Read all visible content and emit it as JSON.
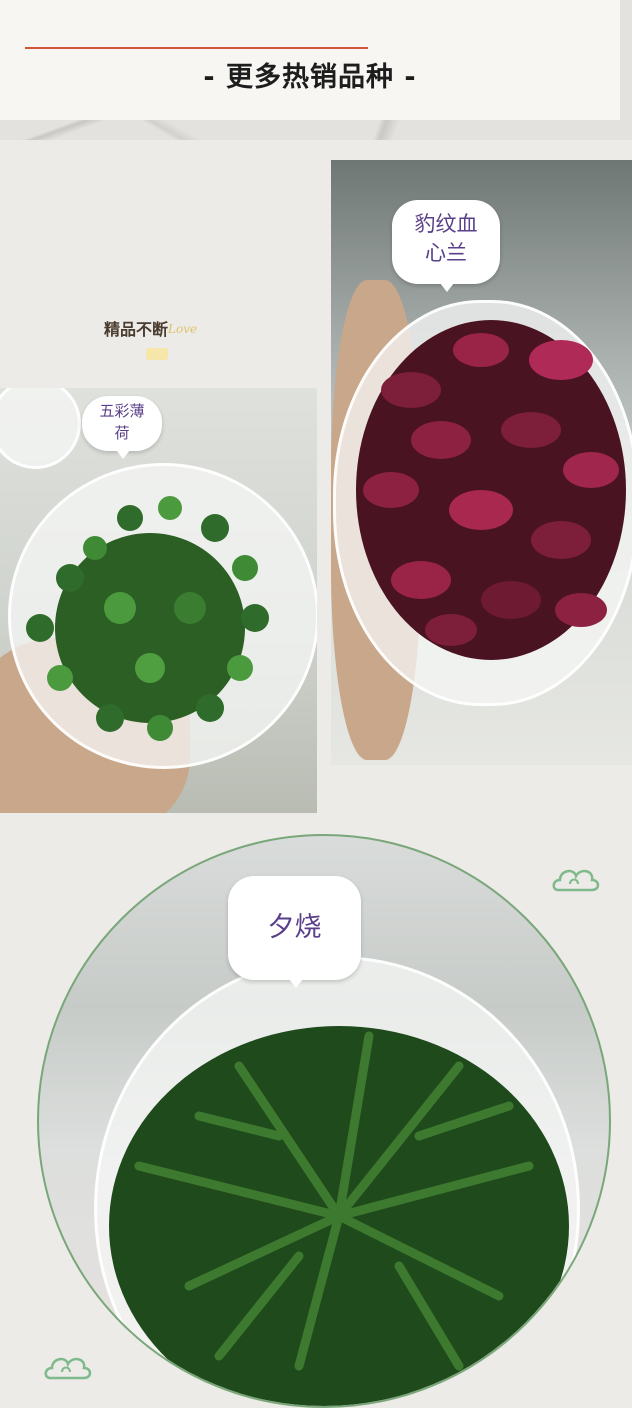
{
  "header": {
    "title": "- 更多热销品种 -"
  },
  "tagline": {
    "text": "精品不断",
    "script": "Love"
  },
  "products": [
    {
      "name": "五彩薄荷",
      "line1": "五彩薄",
      "line2": "荷"
    },
    {
      "name": "豹纹血心兰",
      "line1": "豹纹血",
      "line2": "心兰"
    },
    {
      "name": "夕烧",
      "line1": "夕烧",
      "line2": ""
    }
  ],
  "colors": {
    "accent_line": "#d0553b",
    "bubble_text": "#5a3f8a",
    "cloud": "#7fb98c",
    "circle_border": "#7aa77a"
  },
  "decor": {
    "cloud_icon": "auspicious-cloud-icon"
  }
}
